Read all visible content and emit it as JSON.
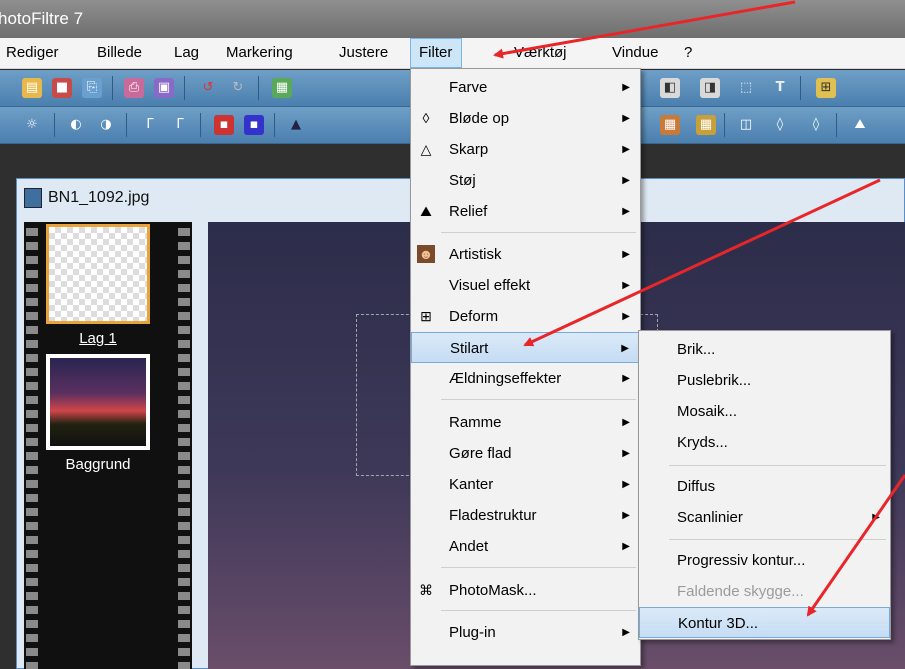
{
  "window": {
    "title": "hotoFiltre 7"
  },
  "menubar": {
    "items": [
      {
        "label": "Rediger"
      },
      {
        "label": "Billede"
      },
      {
        "label": "Lag"
      },
      {
        "label": "Markering"
      },
      {
        "label": "Justere"
      },
      {
        "label": "Filter"
      },
      {
        "label": "Værktøj"
      },
      {
        "label": "Vindue"
      },
      {
        "label": "?"
      }
    ]
  },
  "document": {
    "title": "BN1_1092.jpg",
    "layers": [
      {
        "label": "Lag 1"
      },
      {
        "label": "Baggrund"
      }
    ]
  },
  "filter_menu": {
    "items": [
      {
        "label": "Farve"
      },
      {
        "label": "Bløde op"
      },
      {
        "label": "Skarp"
      },
      {
        "label": "Støj"
      },
      {
        "label": "Relief"
      },
      {
        "label": "Artistisk"
      },
      {
        "label": "Visuel effekt"
      },
      {
        "label": "Deform"
      },
      {
        "label": "Stilart"
      },
      {
        "label": "Ældningseffekter"
      },
      {
        "label": "Ramme"
      },
      {
        "label": "Gøre flad"
      },
      {
        "label": "Kanter"
      },
      {
        "label": "Fladestruktur"
      },
      {
        "label": "Andet"
      },
      {
        "label": "PhotoMask..."
      },
      {
        "label": "Plug-in"
      }
    ]
  },
  "stilart_menu": {
    "items": [
      {
        "label": "Brik..."
      },
      {
        "label": "Puslebrik..."
      },
      {
        "label": "Mosaik..."
      },
      {
        "label": "Kryds..."
      },
      {
        "label": "Diffus"
      },
      {
        "label": "Scanlinier"
      },
      {
        "label": "Progressiv kontur..."
      },
      {
        "label": "Faldende skygge..."
      },
      {
        "label": "Kontur 3D..."
      }
    ]
  },
  "colors": {
    "annotation_arrow": "#e8262a",
    "highlight": "#c5dcf3",
    "toolbar": "#5a8cba"
  }
}
